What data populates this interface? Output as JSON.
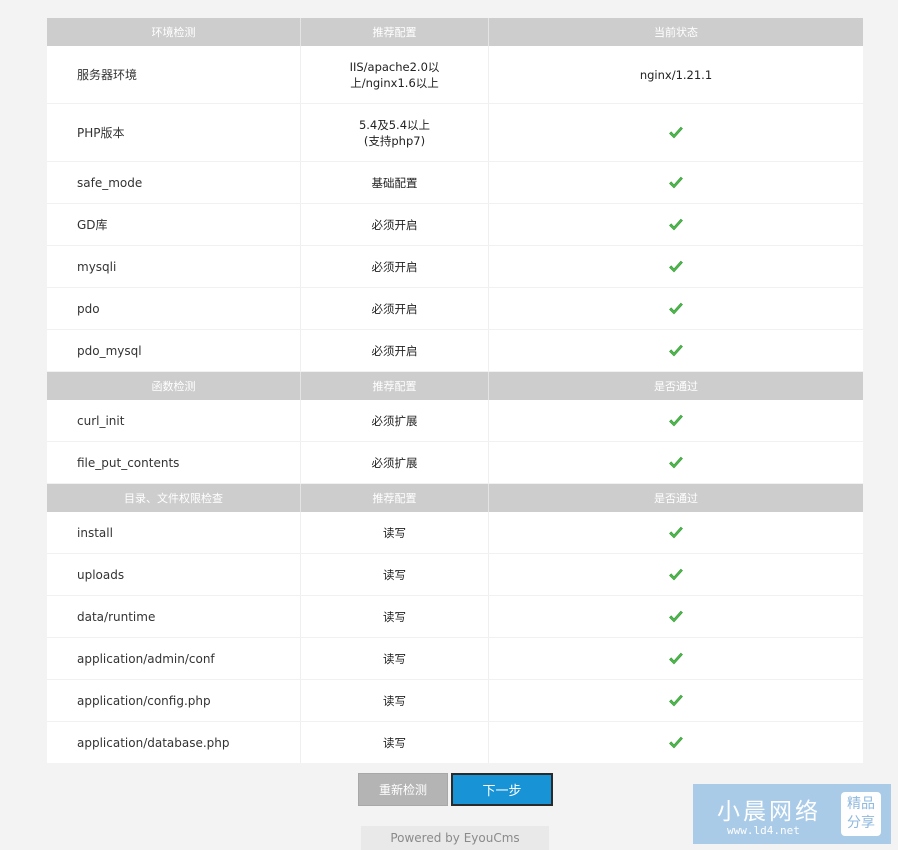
{
  "env_section": {
    "headers": [
      "环境检测",
      "推荐配置",
      "当前状态"
    ],
    "rows": [
      {
        "name": "服务器环境",
        "recommended": "IIS/apache2.0以上/nginx1.6以上",
        "status_text": "nginx/1.21.1"
      },
      {
        "name": "PHP版本",
        "recommended": "5.4及5.4以上(支持php7)",
        "status_text": ""
      },
      {
        "name": "safe_mode",
        "recommended": "基础配置",
        "status_text": ""
      },
      {
        "name": "GD库",
        "recommended": "必须开启",
        "status_text": ""
      },
      {
        "name": "mysqli",
        "recommended": "必须开启",
        "status_text": ""
      },
      {
        "name": "pdo",
        "recommended": "必须开启",
        "status_text": ""
      },
      {
        "name": "pdo_mysql",
        "recommended": "必须开启",
        "status_text": ""
      }
    ],
    "recommended_lines": {
      "server": [
        "IIS/apache2.0以",
        "上/nginx1.6以上"
      ],
      "php": [
        "5.4及5.4以上",
        "(支持php7)"
      ]
    }
  },
  "func_section": {
    "headers": [
      "函数检测",
      "推荐配置",
      "是否通过"
    ],
    "rows": [
      {
        "name": "curl_init",
        "recommended": "必须扩展"
      },
      {
        "name": "file_put_contents",
        "recommended": "必须扩展"
      }
    ]
  },
  "dir_section": {
    "headers": [
      "目录、文件权限检查",
      "推荐配置",
      "是否通过"
    ],
    "rows": [
      {
        "name": "install",
        "recommended": "读写"
      },
      {
        "name": "uploads",
        "recommended": "读写"
      },
      {
        "name": "data/runtime",
        "recommended": "读写"
      },
      {
        "name": "application/admin/conf",
        "recommended": "读写"
      },
      {
        "name": "application/config.php",
        "recommended": "读写"
      },
      {
        "name": "application/database.php",
        "recommended": "读写"
      }
    ]
  },
  "buttons": {
    "recheck": "重新检测",
    "next": "下一步"
  },
  "footer": "Powered by EyouCms",
  "watermark": {
    "name": "小晨网络",
    "url": "www.ld4.net",
    "badge_line1": "精品",
    "badge_line2": "分享"
  },
  "icons": {
    "status_ok": "check-icon"
  },
  "colors": {
    "header_bg": "#cdcdcd",
    "check_green": "#4cb94c",
    "next_button": "#1793d6",
    "recheck_button": "#b4b4b4"
  }
}
